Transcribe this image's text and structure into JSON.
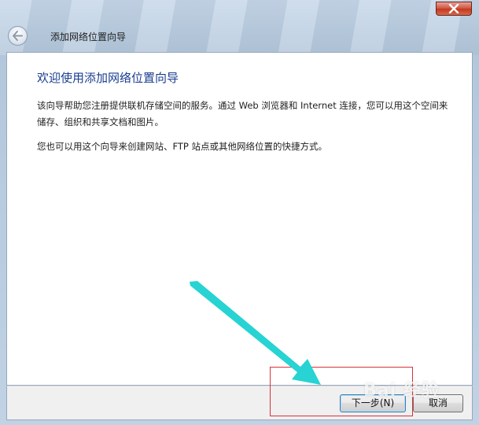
{
  "window": {
    "title": "添加网络位置向导",
    "close_icon": "close-icon",
    "back_icon": "back-arrow-icon"
  },
  "content": {
    "heading": "欢迎使用添加网络位置向导",
    "paragraph_1": "该向导帮助您注册提供联机存储空间的服务。通过 Web 浏览器和 Internet 连接，您可以用这个空间来储存、组织和共享文档和图片。",
    "paragraph_2": "您也可以用这个向导来创建网站、FTP 站点或其他网络位置的快捷方式。"
  },
  "footer": {
    "next_label": "下一步(N)",
    "cancel_label": "取消"
  },
  "overlay": {
    "watermark_text": "Bai 经验",
    "arrow_color": "#27d3d3",
    "highlight_color": "#d9323a"
  }
}
